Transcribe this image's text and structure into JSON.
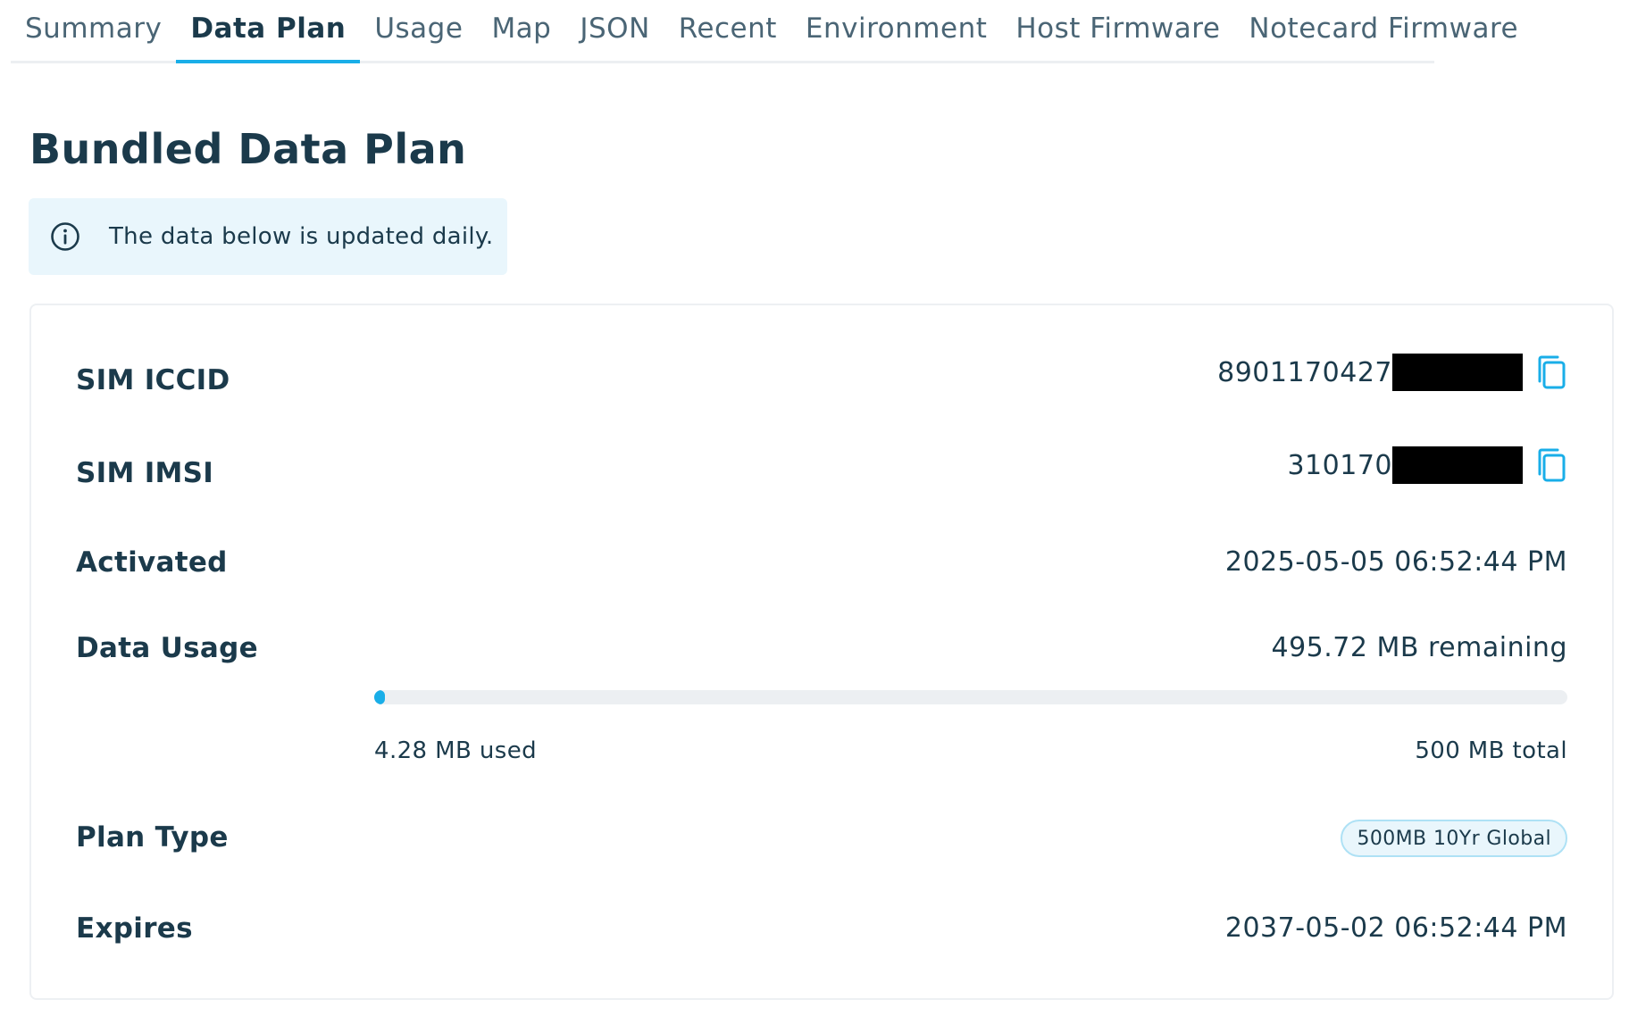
{
  "tabs": [
    {
      "label": "Summary",
      "active": false
    },
    {
      "label": "Data Plan",
      "active": true
    },
    {
      "label": "Usage",
      "active": false
    },
    {
      "label": "Map",
      "active": false
    },
    {
      "label": "JSON",
      "active": false
    },
    {
      "label": "Recent",
      "active": false
    },
    {
      "label": "Environment",
      "active": false
    },
    {
      "label": "Host Firmware",
      "active": false
    },
    {
      "label": "Notecard Firmware",
      "active": false
    }
  ],
  "page": {
    "title": "Bundled Data Plan"
  },
  "info_banner": {
    "icon": "info-icon",
    "text": "The data below is updated daily."
  },
  "details": {
    "sim_iccid": {
      "label": "SIM ICCID",
      "value_visible": "8901170427",
      "redacted": true,
      "copy_icon": "copy-icon"
    },
    "sim_imsi": {
      "label": "SIM IMSI",
      "value_visible": "310170",
      "redacted": true,
      "copy_icon": "copy-icon"
    },
    "activated": {
      "label": "Activated",
      "value": "2025-05-05 06:52:44 PM"
    },
    "data_usage": {
      "label": "Data Usage",
      "remaining": "495.72 MB remaining",
      "used": "4.28 MB used",
      "total": "500 MB total",
      "used_fraction": 0.00856
    },
    "plan_type": {
      "label": "Plan Type",
      "value": "500MB 10Yr Global"
    },
    "expires": {
      "label": "Expires",
      "value": "2037-05-02 06:52:44 PM"
    }
  },
  "colors": {
    "accent": "#19aee8",
    "text": "#1b3a4b",
    "banner_bg": "#e9f6fc",
    "track": "#eceff2"
  }
}
